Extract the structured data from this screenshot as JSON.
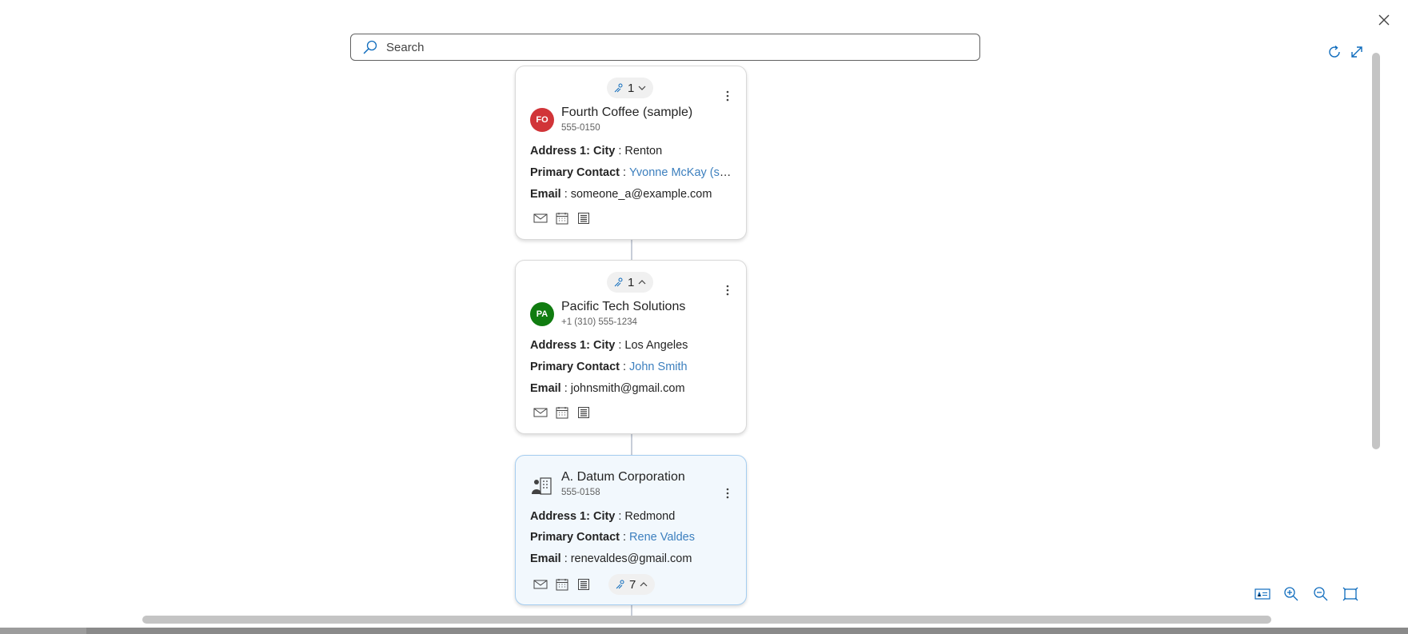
{
  "search": {
    "placeholder": "Search"
  },
  "cards": [
    {
      "pill_count": "1",
      "avatar": "FO",
      "avatar_color": "#d13438",
      "name": "Fourth Coffee (sample)",
      "phone": "555-0150",
      "fields": [
        {
          "label": "Address 1: City",
          "value": "Renton"
        },
        {
          "label": "Primary Contact",
          "value": "Yvonne McKay (sa..."
        },
        {
          "label": "Email",
          "value": "someone_a@example.com"
        }
      ]
    },
    {
      "pill_count": "1",
      "avatar": "PA",
      "avatar_color": "#107c10",
      "name": "Pacific Tech Solutions",
      "phone": "+1 (310) 555-1234",
      "fields": [
        {
          "label": "Address 1: City",
          "value": "Los Angeles"
        },
        {
          "label": "Primary Contact",
          "value": "John Smith"
        },
        {
          "label": "Email",
          "value": "johnsmith@gmail.com"
        }
      ]
    },
    {
      "pill_count": "7",
      "avatar": "building-people-icon",
      "name": "A. Datum Corporation",
      "phone": "555-0158",
      "fields": [
        {
          "label": "Address 1: City",
          "value": "Redmond"
        },
        {
          "label": "Primary Contact",
          "value": "Rene Valdes"
        },
        {
          "label": "Email",
          "value": "renevaldes@gmail.com"
        }
      ]
    }
  ],
  "icons": {
    "close": "close-icon",
    "refresh": "refresh-icon",
    "expand": "expand-icon",
    "card_view": "card-view-icon",
    "zoom_in": "zoom-in-icon",
    "zoom_out": "zoom-out-icon",
    "fit": "fit-to-screen-icon"
  },
  "colors": {
    "accent": "#0f6cbd",
    "link": "#3c7fbe",
    "selected_bg": "#f2f8fd"
  }
}
